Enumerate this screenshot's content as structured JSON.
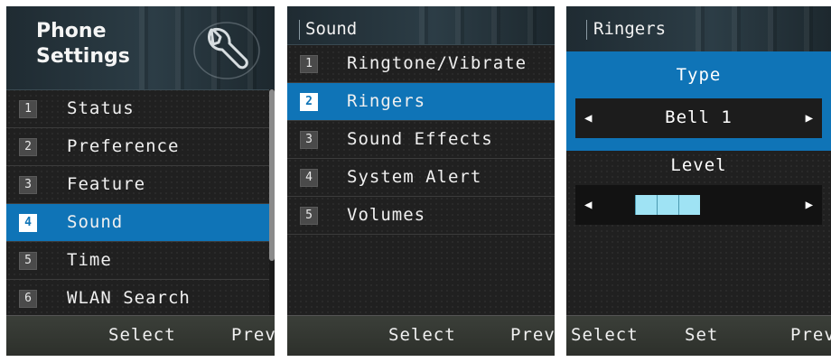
{
  "screen1": {
    "title_line1": "Phone",
    "title_line2": "Settings",
    "items": [
      {
        "num": "1",
        "label": "Status"
      },
      {
        "num": "2",
        "label": "Preference"
      },
      {
        "num": "3",
        "label": "Feature"
      },
      {
        "num": "4",
        "label": "Sound"
      },
      {
        "num": "5",
        "label": "Time"
      },
      {
        "num": "6",
        "label": "WLAN Search"
      }
    ],
    "selected_index": 3,
    "softkeys": {
      "center": "Select",
      "right": "Prev"
    }
  },
  "screen2": {
    "title": "Sound",
    "items": [
      {
        "num": "1",
        "label": "Ringtone/Vibrate"
      },
      {
        "num": "2",
        "label": "Ringers"
      },
      {
        "num": "3",
        "label": "Sound Effects"
      },
      {
        "num": "4",
        "label": "System Alert"
      },
      {
        "num": "5",
        "label": "Volumes"
      }
    ],
    "selected_index": 1,
    "softkeys": {
      "center": "Select",
      "right": "Prev"
    }
  },
  "screen3": {
    "title": "Ringers",
    "type_label": "Type",
    "type_value": "Bell 1",
    "level_label": "Level",
    "level_value": 3,
    "softkeys": {
      "left": "Select",
      "center": "Set",
      "right": "Prev"
    }
  },
  "colors": {
    "selection": "#0f74b7",
    "background": "#202020",
    "level_fill": "#9fe3f4"
  },
  "icons": [
    "wrench-icon",
    "left-arrow-icon",
    "right-arrow-icon"
  ]
}
